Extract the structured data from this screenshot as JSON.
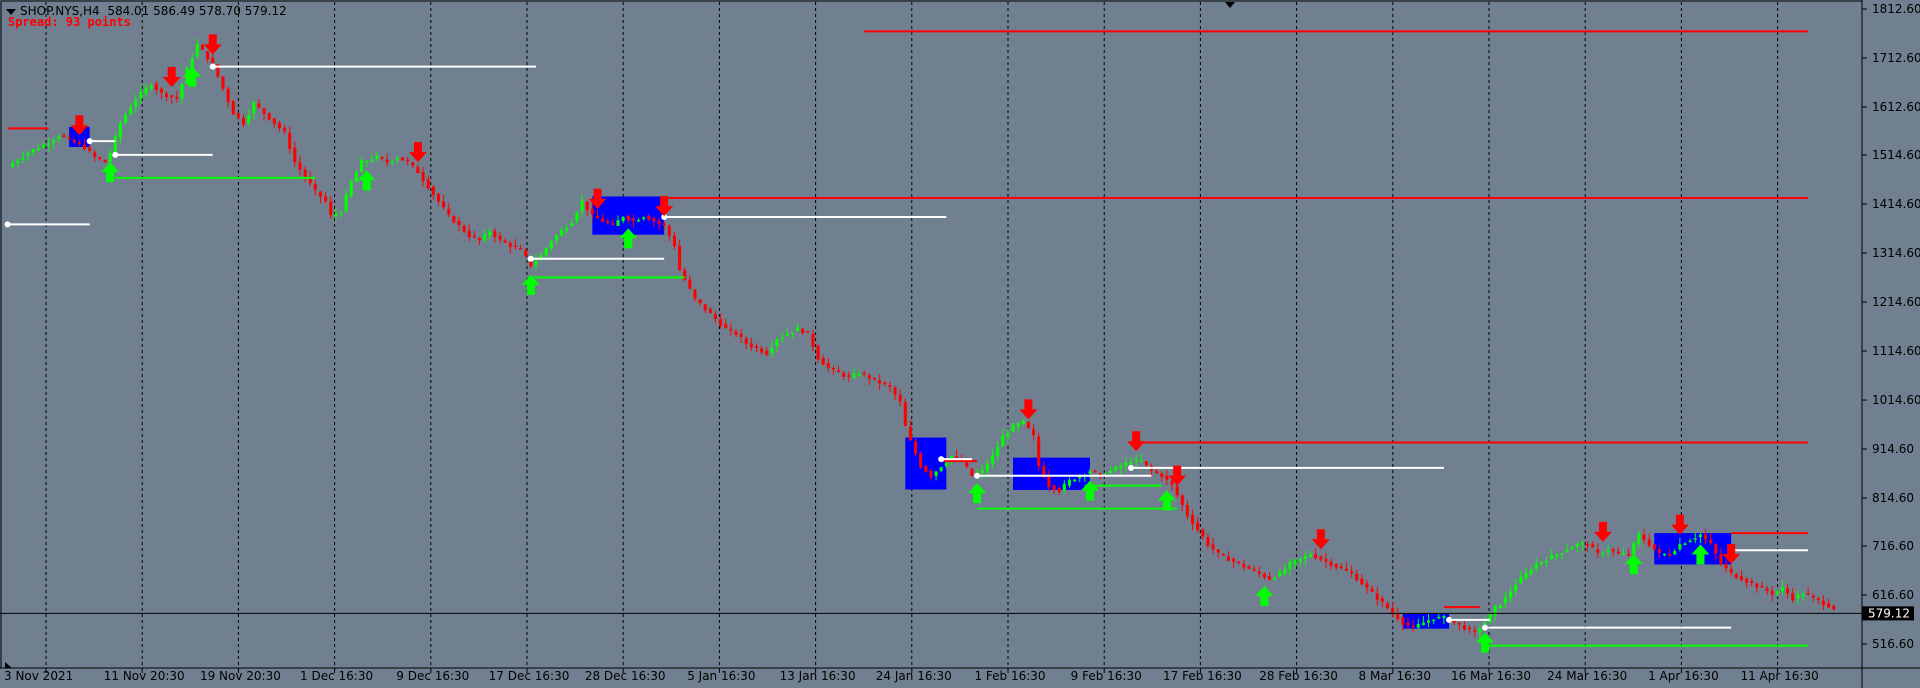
{
  "header": {
    "symbol": "SHOP.NYS,H4",
    "ohlc": "584.01 586.49 578.70 579.12",
    "spread": "Spread: 93 points"
  },
  "colors": {
    "background": "#708090",
    "bull": "#00ff00",
    "bear": "#ff0000",
    "zone": "#0000ff",
    "level_white": "#ffffff",
    "grid": "#000000"
  },
  "chart_data": {
    "type": "candlestick",
    "ylim": [
      480,
      1830
    ],
    "y_ticks": [
      "1812.60",
      "1712.60",
      "1612.60",
      "1514.60",
      "1414.60",
      "1314.60",
      "1214.60",
      "1114.60",
      "1014.60",
      "914.60",
      "814.60",
      "716.60",
      "616.60",
      "516.60"
    ],
    "x_ticks": [
      "3 Nov 2021",
      "11 Nov 20:30",
      "19 Nov 20:30",
      "1 Dec 16:30",
      "9 Dec 16:30",
      "17 Dec 16:30",
      "28 Dec 16:30",
      "5 Jan 16:30",
      "13 Jan 16:30",
      "24 Jan 16:30",
      "1 Feb 16:30",
      "9 Feb 16:30",
      "17 Feb 16:30",
      "28 Feb 16:30",
      "8 Mar 16:30",
      "16 Mar 16:30",
      "24 Mar 16:30",
      "1 Apr 16:30",
      "11 Apr 16:30"
    ],
    "current_price": "579.12",
    "close_path": [
      [
        0,
        1490
      ],
      [
        4,
        1520
      ],
      [
        8,
        1540
      ],
      [
        10,
        1555
      ],
      [
        13,
        1540
      ],
      [
        15,
        1530
      ],
      [
        17,
        1510
      ],
      [
        19,
        1500
      ],
      [
        20,
        1520
      ],
      [
        22,
        1580
      ],
      [
        25,
        1630
      ],
      [
        28,
        1660
      ],
      [
        30,
        1640
      ],
      [
        33,
        1630
      ],
      [
        35,
        1690
      ],
      [
        37,
        1740
      ],
      [
        40,
        1700
      ],
      [
        42,
        1650
      ],
      [
        44,
        1600
      ],
      [
        46,
        1580
      ],
      [
        48,
        1620
      ],
      [
        50,
        1600
      ],
      [
        52,
        1580
      ],
      [
        54,
        1560
      ],
      [
        56,
        1500
      ],
      [
        58,
        1470
      ],
      [
        60,
        1440
      ],
      [
        62,
        1420
      ],
      [
        63,
        1390
      ],
      [
        65,
        1400
      ],
      [
        67,
        1460
      ],
      [
        69,
        1500
      ],
      [
        72,
        1510
      ],
      [
        74,
        1500
      ],
      [
        76,
        1510
      ],
      [
        78,
        1500
      ],
      [
        80,
        1480
      ],
      [
        82,
        1450
      ],
      [
        84,
        1420
      ],
      [
        86,
        1390
      ],
      [
        88,
        1370
      ],
      [
        90,
        1350
      ],
      [
        92,
        1340
      ],
      [
        94,
        1360
      ],
      [
        96,
        1340
      ],
      [
        98,
        1330
      ],
      [
        100,
        1320
      ],
      [
        102,
        1290
      ],
      [
        104,
        1310
      ],
      [
        106,
        1340
      ],
      [
        108,
        1360
      ],
      [
        110,
        1380
      ],
      [
        112,
        1420
      ],
      [
        114,
        1390
      ],
      [
        116,
        1380
      ],
      [
        118,
        1370
      ],
      [
        120,
        1390
      ],
      [
        122,
        1380
      ],
      [
        124,
        1390
      ],
      [
        126,
        1380
      ],
      [
        128,
        1370
      ],
      [
        130,
        1330
      ],
      [
        131,
        1280
      ],
      [
        132,
        1260
      ],
      [
        134,
        1220
      ],
      [
        136,
        1200
      ],
      [
        138,
        1180
      ],
      [
        140,
        1160
      ],
      [
        142,
        1150
      ],
      [
        144,
        1130
      ],
      [
        146,
        1120
      ],
      [
        148,
        1110
      ],
      [
        150,
        1140
      ],
      [
        152,
        1150
      ],
      [
        154,
        1160
      ],
      [
        156,
        1150
      ],
      [
        158,
        1100
      ],
      [
        160,
        1080
      ],
      [
        162,
        1070
      ],
      [
        164,
        1060
      ],
      [
        166,
        1070
      ],
      [
        168,
        1060
      ],
      [
        170,
        1050
      ],
      [
        172,
        1040
      ],
      [
        174,
        1010
      ],
      [
        175,
        960
      ],
      [
        176,
        930
      ],
      [
        178,
        880
      ],
      [
        180,
        860
      ],
      [
        182,
        880
      ],
      [
        184,
        900
      ],
      [
        186,
        890
      ],
      [
        188,
        860
      ],
      [
        190,
        870
      ],
      [
        192,
        900
      ],
      [
        194,
        940
      ],
      [
        196,
        960
      ],
      [
        198,
        970
      ],
      [
        200,
        940
      ],
      [
        201,
        880
      ],
      [
        203,
        840
      ],
      [
        205,
        830
      ],
      [
        207,
        850
      ],
      [
        209,
        860
      ],
      [
        211,
        870
      ],
      [
        213,
        860
      ],
      [
        215,
        870
      ],
      [
        217,
        880
      ],
      [
        219,
        890
      ],
      [
        221,
        890
      ],
      [
        223,
        870
      ],
      [
        225,
        860
      ],
      [
        227,
        840
      ],
      [
        228,
        820
      ],
      [
        230,
        780
      ],
      [
        232,
        750
      ],
      [
        234,
        720
      ],
      [
        236,
        700
      ],
      [
        238,
        690
      ],
      [
        240,
        680
      ],
      [
        242,
        670
      ],
      [
        244,
        660
      ],
      [
        246,
        650
      ],
      [
        248,
        660
      ],
      [
        250,
        680
      ],
      [
        252,
        690
      ],
      [
        254,
        700
      ],
      [
        256,
        690
      ],
      [
        258,
        680
      ],
      [
        260,
        670
      ],
      [
        262,
        660
      ],
      [
        264,
        640
      ],
      [
        266,
        620
      ],
      [
        268,
        600
      ],
      [
        270,
        580
      ],
      [
        272,
        560
      ],
      [
        274,
        550
      ],
      [
        276,
        560
      ],
      [
        278,
        570
      ],
      [
        280,
        570
      ],
      [
        282,
        560
      ],
      [
        284,
        550
      ],
      [
        286,
        540
      ],
      [
        288,
        560
      ],
      [
        290,
        590
      ],
      [
        292,
        610
      ],
      [
        294,
        640
      ],
      [
        296,
        660
      ],
      [
        298,
        680
      ],
      [
        300,
        690
      ],
      [
        302,
        700
      ],
      [
        304,
        710
      ],
      [
        306,
        720
      ],
      [
        308,
        720
      ],
      [
        310,
        700
      ],
      [
        312,
        710
      ],
      [
        314,
        700
      ],
      [
        316,
        700
      ],
      [
        318,
        740
      ],
      [
        320,
        720
      ],
      [
        322,
        700
      ],
      [
        324,
        700
      ],
      [
        326,
        720
      ],
      [
        328,
        730
      ],
      [
        330,
        740
      ],
      [
        332,
        720
      ],
      [
        334,
        680
      ],
      [
        336,
        660
      ],
      [
        338,
        650
      ],
      [
        340,
        640
      ],
      [
        342,
        630
      ],
      [
        344,
        620
      ],
      [
        346,
        630
      ],
      [
        348,
        610
      ],
      [
        350,
        620
      ],
      [
        352,
        610
      ],
      [
        354,
        600
      ],
      [
        356,
        590
      ]
    ],
    "horizontal_levels": [
      {
        "color": "red",
        "price": 1767,
        "x0": 167,
        "x1": 360
      },
      {
        "color": "red",
        "price": 1569,
        "x0": 0,
        "x1": 8
      },
      {
        "color": "red",
        "price": 1427,
        "x0": 128,
        "x1": 360
      },
      {
        "color": "red",
        "price": 928,
        "x0": 219,
        "x1": 360
      },
      {
        "color": "red",
        "price": 890,
        "x0": 182,
        "x1": 189
      },
      {
        "color": "red",
        "price": 743,
        "x0": 336,
        "x1": 360
      },
      {
        "color": "red",
        "price": 592,
        "x0": 280,
        "x1": 287
      },
      {
        "color": "white",
        "price": 1695,
        "x0": 40,
        "x1": 103
      },
      {
        "color": "white",
        "price": 1543,
        "x0": 16,
        "x1": 21
      },
      {
        "color": "white",
        "price": 1515,
        "x0": 21,
        "x1": 40
      },
      {
        "color": "white",
        "price": 1388,
        "x0": 128,
        "x1": 183
      },
      {
        "color": "white",
        "price": 1373,
        "x0": 0,
        "x1": 16
      },
      {
        "color": "white",
        "price": 1303,
        "x0": 102,
        "x1": 128
      },
      {
        "color": "white",
        "price": 894,
        "x0": 182,
        "x1": 188
      },
      {
        "color": "white",
        "price": 876,
        "x0": 219,
        "x1": 280
      },
      {
        "color": "white",
        "price": 860,
        "x0": 189,
        "x1": 223
      },
      {
        "color": "white",
        "price": 708,
        "x0": 336,
        "x1": 360
      },
      {
        "color": "white",
        "price": 566,
        "x0": 281,
        "x1": 289
      },
      {
        "color": "white",
        "price": 550,
        "x0": 288,
        "x1": 336
      },
      {
        "color": "green",
        "price": 1468,
        "x0": 21,
        "x1": 60
      },
      {
        "color": "green",
        "price": 1265,
        "x0": 102,
        "x1": 132
      },
      {
        "color": "green",
        "price": 840,
        "x0": 210,
        "x1": 225
      },
      {
        "color": "green",
        "price": 793,
        "x0": 189,
        "x1": 228
      },
      {
        "color": "green",
        "price": 513,
        "x0": 288,
        "x1": 360
      }
    ],
    "zones": [
      {
        "x0": 12,
        "x1": 16,
        "p_top": 1572,
        "p_bot": 1531
      },
      {
        "x0": 114,
        "x1": 128,
        "p_top": 1430,
        "p_bot": 1352
      },
      {
        "x0": 175,
        "x1": 183,
        "p_top": 938,
        "p_bot": 832
      },
      {
        "x0": 196,
        "x1": 211,
        "p_top": 897,
        "p_bot": 831
      },
      {
        "x0": 272,
        "x1": 281,
        "p_top": 578,
        "p_bot": 548
      },
      {
        "x0": 321,
        "x1": 336,
        "p_top": 743,
        "p_bot": 679
      }
    ],
    "arrows_down": [
      14,
      32,
      40,
      80,
      115,
      128,
      199,
      220,
      228,
      256,
      311,
      326,
      336
    ],
    "arrows_up": [
      20,
      36,
      70,
      102,
      121,
      189,
      211,
      226,
      245,
      288,
      317,
      330
    ]
  }
}
